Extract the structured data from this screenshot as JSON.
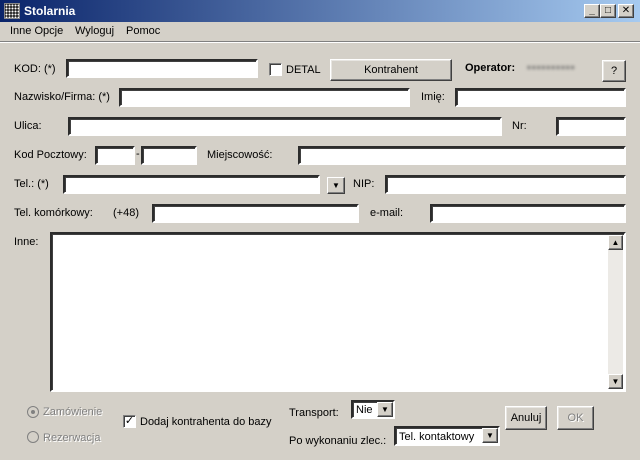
{
  "window": {
    "title": "Stolarnia",
    "minimize_glyph": "_",
    "maximize_glyph": "□",
    "close_glyph": "✕"
  },
  "menu": {
    "items": [
      "Inne Opcje",
      "Wyloguj",
      "Pomoc"
    ]
  },
  "form": {
    "kod_label": "KOD: (*)",
    "kod_value": "",
    "detal_label": "DETAL",
    "detal_checked": false,
    "kontrahent_button": "Kontrahent",
    "operator_label": "Operator:",
    "operator_value": "••••••••••",
    "help_button": "?",
    "nazwisko_label": "Nazwisko/Firma: (*)",
    "nazwisko_value": "",
    "imie_label": "Imię:",
    "imie_value": "",
    "ulica_label": "Ulica:",
    "ulica_value": "",
    "nr_label": "Nr:",
    "nr_value": "",
    "kod_pocztowy_label": "Kod Pocztowy:",
    "kod_pocztowy_sep": "-",
    "kod_pocztowy_1": "",
    "kod_pocztowy_2": "",
    "miejscowosc_label": "Miejscowość:",
    "miejscowosc_value": "",
    "tel_label": "Tel.: (*)",
    "tel_value": "",
    "nip_label": "NIP:",
    "nip_value": "",
    "tel_kom_label": "Tel. komórkowy:",
    "tel_kom_prefix": "(+48)",
    "tel_kom_value": "",
    "email_label": "e-mail:",
    "email_value": "",
    "inne_label": "Inne:",
    "inne_value": ""
  },
  "footer": {
    "zamowienie_label": "Zamówienie",
    "rezerwacja_label": "Rezerwacja",
    "dodaj_label": "Dodaj kontrahenta do bazy",
    "dodaj_checked": true,
    "transport_label": "Transport:",
    "transport_value": "Nie",
    "po_wykonaniu_label": "Po wykonaniu zlec.:",
    "po_wykonaniu_value": "Tel. kontaktowy",
    "anuluj_button": "Anuluj",
    "ok_button": "OK"
  },
  "colors": {
    "face": "#d4d0c8",
    "title_start": "#0a246a",
    "title_end": "#a6caf0",
    "disabled_text": "#808080"
  }
}
